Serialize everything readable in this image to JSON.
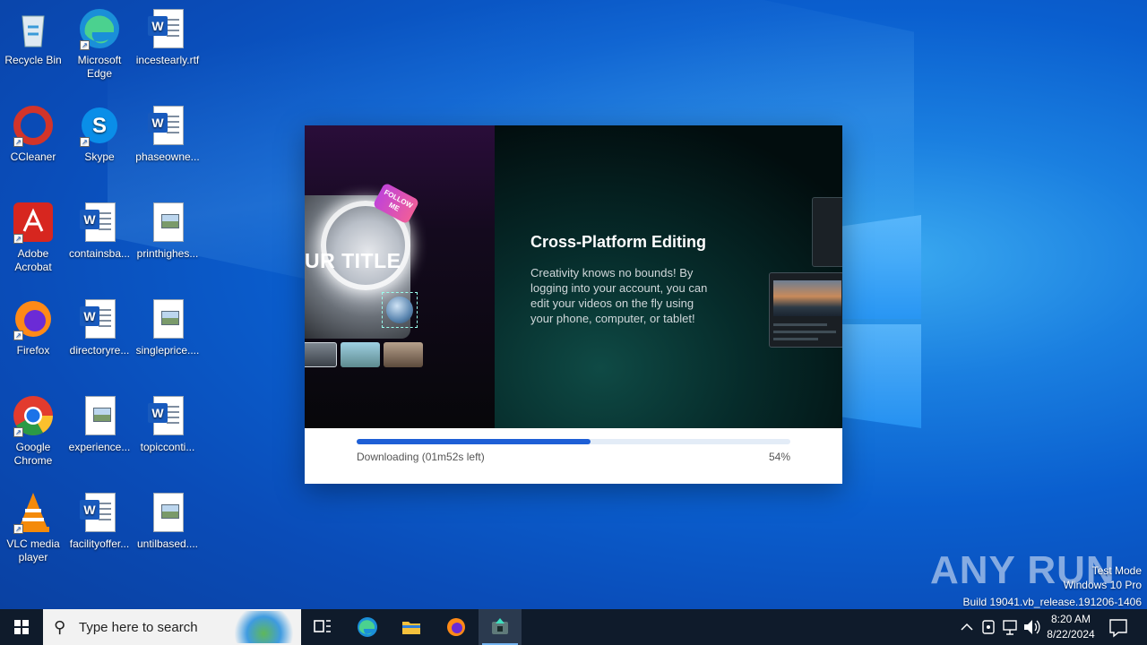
{
  "desktop": {
    "icons": [
      {
        "label": "Recycle Bin",
        "icon": "recycle-bin-icon"
      },
      {
        "label": "Microsoft Edge",
        "icon": "edge-icon"
      },
      {
        "label": "incestearly.rtf",
        "icon": "word-document-icon"
      },
      {
        "label": "CCleaner",
        "icon": "ccleaner-icon"
      },
      {
        "label": "Skype",
        "icon": "skype-icon"
      },
      {
        "label": "phaseowne...",
        "icon": "word-document-icon"
      },
      {
        "label": "Adobe Acrobat",
        "icon": "acrobat-icon"
      },
      {
        "label": "containsba...",
        "icon": "word-document-icon"
      },
      {
        "label": "printhighes...",
        "icon": "image-file-icon"
      },
      {
        "label": "Firefox",
        "icon": "firefox-icon"
      },
      {
        "label": "directoryre...",
        "icon": "word-document-icon"
      },
      {
        "label": "singleprice....",
        "icon": "image-file-icon"
      },
      {
        "label": "Google Chrome",
        "icon": "chrome-icon"
      },
      {
        "label": "experience...",
        "icon": "image-file-icon"
      },
      {
        "label": "topicconti...",
        "icon": "word-document-icon"
      },
      {
        "label": "VLC media player",
        "icon": "vlc-icon"
      },
      {
        "label": "facilityoffer...",
        "icon": "word-document-icon"
      },
      {
        "label": "untilbased....",
        "icon": "image-file-icon"
      }
    ]
  },
  "installer": {
    "hero": {
      "title": "Cross-Platform Editing",
      "description": "Creativity knows no bounds! By logging into your account, you can edit your videos on the fly using your phone, computer, or tablet!",
      "overlay_title": "UR TITLE",
      "sticker": "FOLLOW ME"
    },
    "progress": {
      "status": "Downloading (01m52s left)",
      "percent_label": "54%",
      "fraction": 0.54
    }
  },
  "watermark": {
    "brand": "ANY RUN",
    "mode": "Test Mode",
    "os": "Windows 10 Pro",
    "build": "Build 19041.vb_release.191206-1406"
  },
  "taskbar": {
    "search_placeholder": "Type here to search",
    "time": "8:20 AM",
    "date": "8/22/2024"
  },
  "colors": {
    "accent": "#1e5fd6",
    "taskbar": "#0f1b2b"
  }
}
